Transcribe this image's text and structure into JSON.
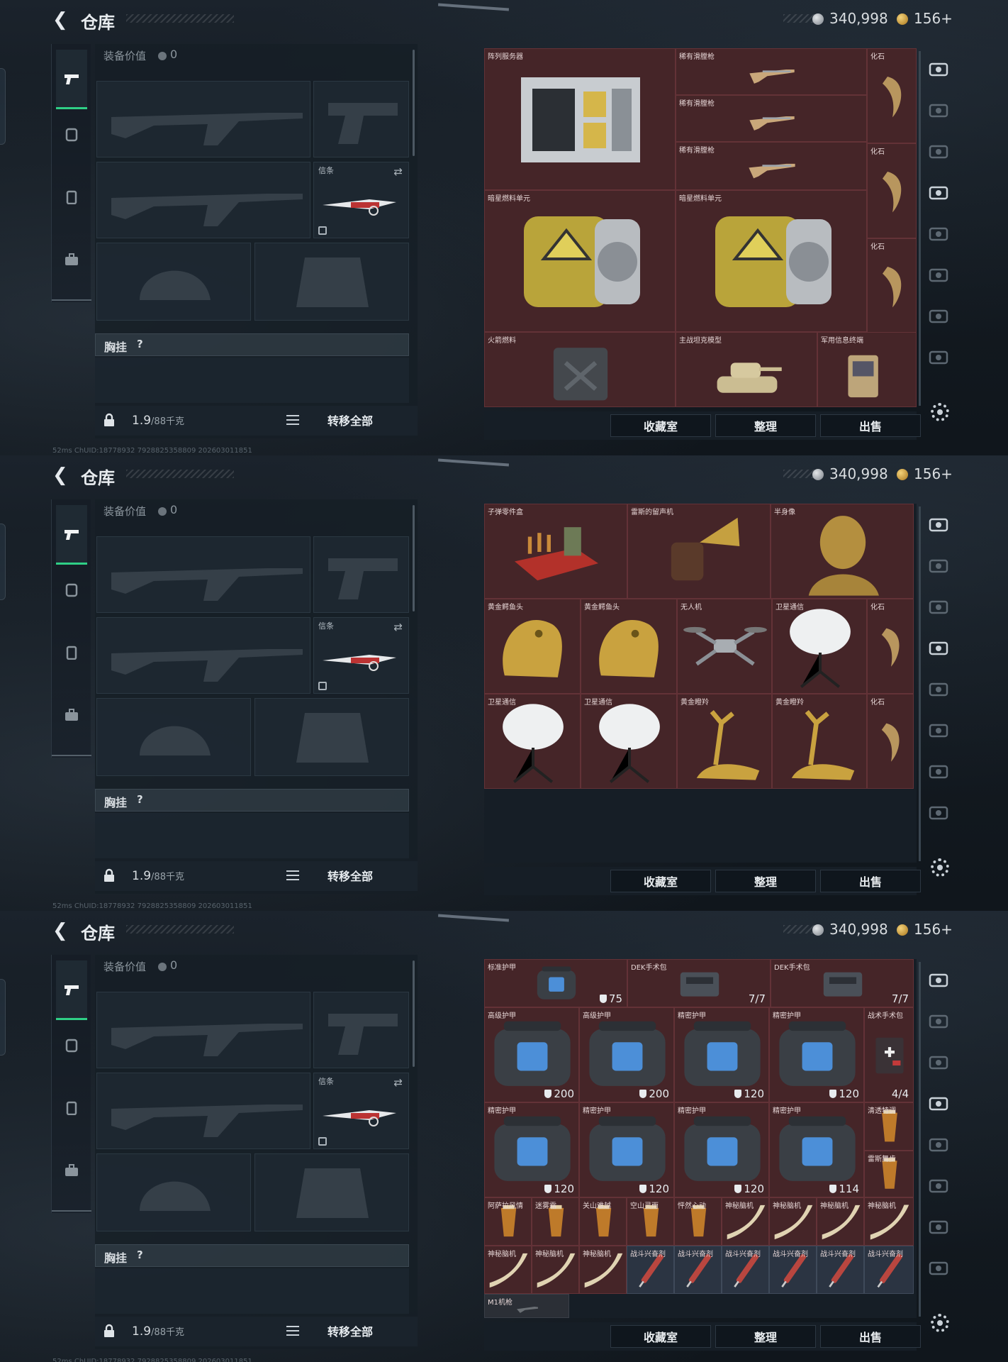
{
  "panels": [
    {
      "title": "仓库",
      "currency": {
        "silver": "340,998",
        "gold": "156+"
      },
      "equipment": {
        "label": "装备价值",
        "value": "0",
        "knife_label": "信条",
        "chest_label": "胸挂",
        "help": "?"
      },
      "bottom": {
        "weight": "1.9",
        "weight_max": "/88千克",
        "transfer_all": "转移全部"
      },
      "actions": {
        "collection": "收藏室",
        "sort": "整理",
        "sell": "出售"
      },
      "status_text": "52ms  ChUID:18778932 7928825358809  202603011851",
      "items": [
        {
          "label": "阵列服务器",
          "count": "",
          "kind": "server"
        },
        {
          "label": "稀有滑膛枪",
          "count": "",
          "kind": "musket"
        },
        {
          "label": "稀有滑膛枪",
          "count": "",
          "kind": "musket"
        },
        {
          "label": "稀有滑膛枪",
          "count": "",
          "kind": "musket"
        },
        {
          "label": "化石",
          "count": "",
          "kind": "fossil"
        },
        {
          "label": "化石",
          "count": "",
          "kind": "fossil"
        },
        {
          "label": "化石",
          "count": "",
          "kind": "fossil"
        },
        {
          "label": "暗星燃料单元",
          "count": "",
          "kind": "fuel"
        },
        {
          "label": "暗星燃料单元",
          "count": "",
          "kind": "fuel"
        },
        {
          "label": "火箭燃料",
          "count": "",
          "kind": "jerry"
        },
        {
          "label": "主战坦克模型",
          "count": "",
          "kind": "tank"
        },
        {
          "label": "军用信息终端",
          "count": "",
          "kind": "terminal"
        }
      ]
    },
    {
      "title": "仓库",
      "currency": {
        "silver": "340,998",
        "gold": "156+"
      },
      "equipment": {
        "label": "装备价值",
        "value": "0",
        "knife_label": "信条",
        "chest_label": "胸挂",
        "help": "?"
      },
      "bottom": {
        "weight": "1.9",
        "weight_max": "/88千克",
        "transfer_all": "转移全部"
      },
      "actions": {
        "collection": "收藏室",
        "sort": "整理",
        "sell": "出售"
      },
      "status_text": "52ms  ChUID:18778932 7928825358809  202603011851",
      "items": [
        {
          "label": "子弹零件盒",
          "count": "",
          "kind": "bullets"
        },
        {
          "label": "雷斯的留声机",
          "count": "",
          "kind": "gramophone"
        },
        {
          "label": "半身像",
          "count": "",
          "kind": "bust"
        },
        {
          "label": "黄金鳄鱼头",
          "count": "",
          "kind": "croc"
        },
        {
          "label": "黄金鳄鱼头",
          "count": "",
          "kind": "croc"
        },
        {
          "label": "无人机",
          "count": "",
          "kind": "drone"
        },
        {
          "label": "卫星通信",
          "count": "",
          "kind": "dish"
        },
        {
          "label": "化石",
          "count": "",
          "kind": "fossil"
        },
        {
          "label": "卫星通信",
          "count": "",
          "kind": "dish"
        },
        {
          "label": "卫星通信",
          "count": "",
          "kind": "dish"
        },
        {
          "label": "黄金瞪羚",
          "count": "",
          "kind": "gazelle"
        },
        {
          "label": "黄金瞪羚",
          "count": "",
          "kind": "gazelle"
        },
        {
          "label": "化石",
          "count": "",
          "kind": "fossil"
        }
      ]
    },
    {
      "title": "仓库",
      "currency": {
        "silver": "340,998",
        "gold": "156+"
      },
      "equipment": {
        "label": "装备价值",
        "value": "0",
        "knife_label": "信条",
        "chest_label": "胸挂",
        "help": "?"
      },
      "bottom": {
        "weight": "1.9",
        "weight_max": "/88千克",
        "transfer_all": "转移全部"
      },
      "actions": {
        "collection": "收藏室",
        "sort": "整理",
        "sell": "出售"
      },
      "status_text": "52ms  ChUID:18778932 7928825358809  202603011851",
      "items": [
        {
          "label": "标准护甲",
          "count": "75",
          "kind": "armor"
        },
        {
          "label": "DEK手术包",
          "count": "7/7",
          "kind": "surgery"
        },
        {
          "label": "DEK手术包",
          "count": "7/7",
          "kind": "surgery"
        },
        {
          "label": "高级护甲",
          "count": "200",
          "kind": "armor"
        },
        {
          "label": "高级护甲",
          "count": "200",
          "kind": "armor"
        },
        {
          "label": "精密护甲",
          "count": "120",
          "kind": "armor"
        },
        {
          "label": "精密护甲",
          "count": "120",
          "kind": "armor"
        },
        {
          "label": "战术手术包",
          "count": "4/4",
          "kind": "medkit"
        },
        {
          "label": "精密护甲",
          "count": "120",
          "kind": "armor"
        },
        {
          "label": "精密护甲",
          "count": "120",
          "kind": "armor"
        },
        {
          "label": "精密护甲",
          "count": "120",
          "kind": "armor"
        },
        {
          "label": "精密护甲",
          "count": "114",
          "kind": "armor"
        },
        {
          "label": "清透特调",
          "count": "",
          "kind": "drink"
        },
        {
          "label": "雷斯舞步",
          "count": "",
          "kind": "drink"
        },
        {
          "label": "阿萨拉风情",
          "count": "",
          "kind": "drink"
        },
        {
          "label": "迷雾霜",
          "count": "",
          "kind": "drink"
        },
        {
          "label": "关山难越",
          "count": "",
          "kind": "drink"
        },
        {
          "label": "空山灵雨",
          "count": "",
          "kind": "drink"
        },
        {
          "label": "怦然心动",
          "count": "",
          "kind": "drink"
        },
        {
          "label": "神秘脑机",
          "count": "",
          "kind": "horn"
        },
        {
          "label": "神秘脑机",
          "count": "",
          "kind": "horn"
        },
        {
          "label": "神秘脑机",
          "count": "",
          "kind": "horn"
        },
        {
          "label": "神秘脑机",
          "count": "",
          "kind": "horn"
        },
        {
          "label": "神秘脑机",
          "count": "",
          "kind": "horn"
        },
        {
          "label": "神秘脑机",
          "count": "",
          "kind": "horn"
        },
        {
          "label": "神秘脑机",
          "count": "",
          "kind": "horn"
        },
        {
          "label": "战斗兴奋剂",
          "count": "",
          "kind": "syringe"
        },
        {
          "label": "战斗兴奋剂",
          "count": "",
          "kind": "syringe"
        },
        {
          "label": "战斗兴奋剂",
          "count": "",
          "kind": "syringe"
        },
        {
          "label": "战斗兴奋剂",
          "count": "",
          "kind": "syringe"
        },
        {
          "label": "战斗兴奋剂",
          "count": "",
          "kind": "syringe"
        },
        {
          "label": "战斗兴奋剂",
          "count": "",
          "kind": "syringe"
        },
        {
          "label": "M1机枪",
          "count": "",
          "kind": "gun"
        }
      ]
    }
  ],
  "colors": {
    "accent_green": "#2fcf86",
    "cell_red": "#452528",
    "cell_blue": "#2b3442"
  }
}
